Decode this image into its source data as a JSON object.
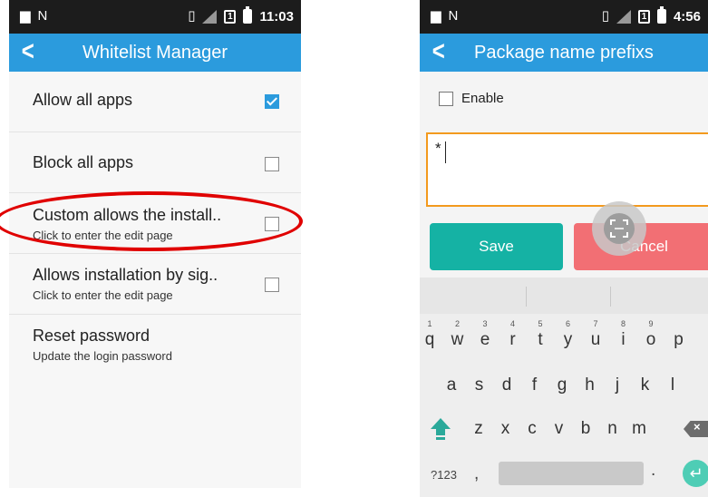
{
  "left_screen": {
    "status": {
      "time": "11:03",
      "sim_label": "1"
    },
    "appbar": {
      "back": "<",
      "title": "Whitelist Manager"
    },
    "items": [
      {
        "title": "Allow all apps",
        "subtitle": "",
        "checked": true
      },
      {
        "title": "Block all apps",
        "subtitle": "",
        "checked": false
      },
      {
        "title": "Custom allows the install..",
        "subtitle": "Click to enter the edit page",
        "checked": false
      },
      {
        "title": "Allows installation by sig..",
        "subtitle": "Click to enter the edit page",
        "checked": false
      },
      {
        "title": "Reset password",
        "subtitle": "Update the login password"
      }
    ]
  },
  "right_screen": {
    "status": {
      "time": "4:56",
      "sim_label": "1"
    },
    "appbar": {
      "back": "<",
      "title": "Package name prefixs"
    },
    "enable_label": "Enable",
    "input_value": "*",
    "save_label": "Save",
    "cancel_label": "Cancel",
    "keyboard": {
      "row1": [
        "q",
        "w",
        "e",
        "r",
        "t",
        "y",
        "u",
        "i",
        "o",
        "p"
      ],
      "row1_hints": [
        "1",
        "2",
        "3",
        "4",
        "5",
        "6",
        "7",
        "8",
        "9",
        ""
      ],
      "row2": [
        "a",
        "s",
        "d",
        "f",
        "g",
        "h",
        "j",
        "k",
        "l"
      ],
      "row3": [
        "z",
        "x",
        "c",
        "v",
        "b",
        "n",
        "m"
      ],
      "backspace": "×",
      "symbols_label": "?123",
      "comma": ",",
      "period": ".",
      "enter": "↵"
    }
  },
  "colors": {
    "appbar": "#2b9bdd",
    "status_bar": "#1c1c1c",
    "save_button": "#15b2a4",
    "cancel_button": "#f26f74",
    "input_border": "#f39a1e",
    "highlight_ellipse": "#e00000"
  }
}
